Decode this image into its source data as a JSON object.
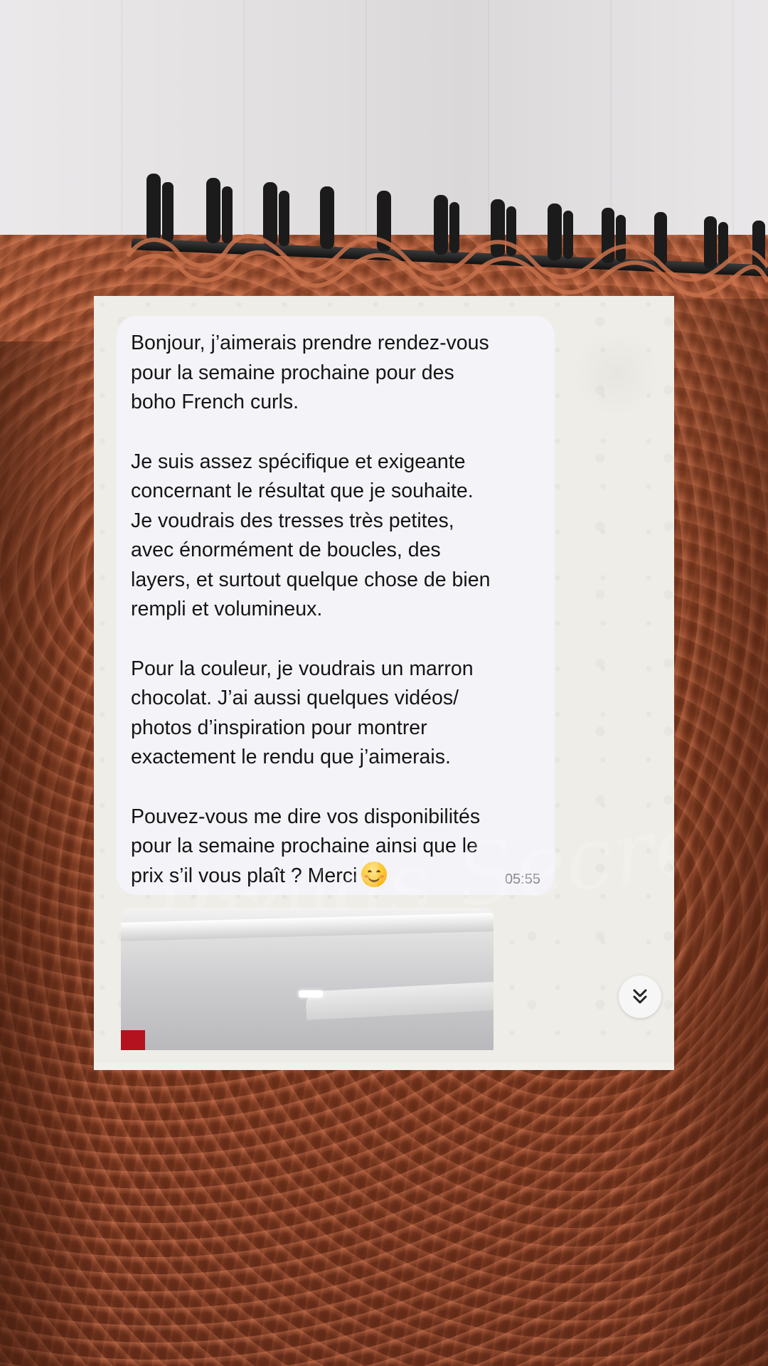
{
  "message": {
    "paragraphs": [
      "Bonjour, j’aimerais prendre rendez-vous\npour la semaine prochaine pour des\nboho French curls.",
      "Je suis assez spécifique et exigeante\nconcernant le résultat que je souhaite.\nJe voudrais des tresses très petites,\navec énormément de boucles, des\nlayers, et surtout quelque chose de bien\nrempli et volumineux.",
      "Pour la couleur, je voudrais un marron\nchocolat. J’ai aussi quelques vidéos/\nphotos d’inspiration pour montrer\nexactement le rendu que j’aimerais.",
      "Pouvez-vous me dire vos disponibilités\npour la semaine prochaine ainsi que le\nprix s’il vous plaît ? Merci"
    ],
    "emoji": "smiling-face-emoji",
    "time": "05:55"
  },
  "watermark": {
    "text": "Braids Secret"
  },
  "attachment": {
    "type": "video-thumbnail"
  },
  "controls": {
    "scroll_down_icon": "double-chevron-down-icon"
  },
  "colors": {
    "bubble_bg": "#f4f3f8",
    "chat_bg": "#efede7",
    "text": "#151515",
    "timestamp": "#8a8a8e"
  }
}
